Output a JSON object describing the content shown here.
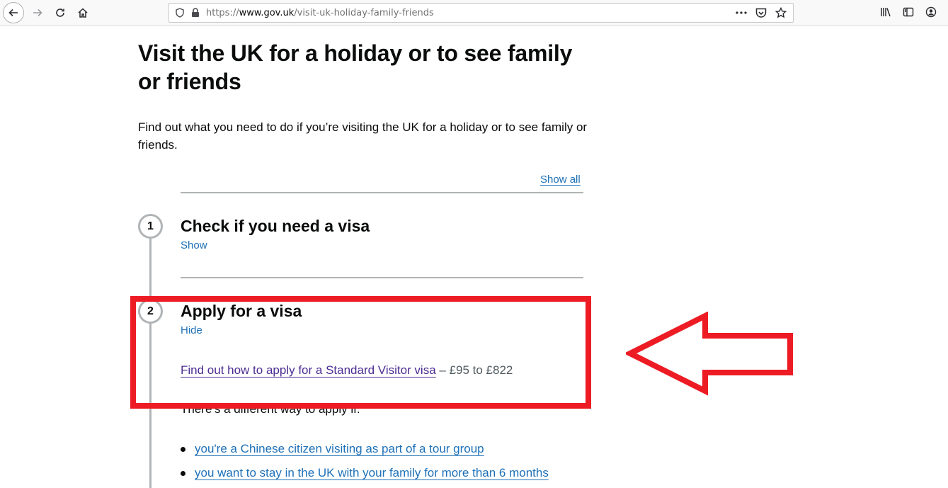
{
  "browser": {
    "url_prefix": "https://",
    "url_host": "www.gov.uk",
    "url_path": "/visit-uk-holiday-family-friends",
    "icons": [
      "back-icon",
      "forward-icon",
      "reload-icon",
      "home-icon",
      "shield-icon",
      "lock-icon",
      "more-icon",
      "pocket-icon",
      "star-icon",
      "library-icon",
      "sidebar-icon",
      "account-icon"
    ]
  },
  "page": {
    "title": "Visit the UK for a holiday or to see family or friends",
    "lead": "Find out what you need to do if you’re visiting the UK for a holiday or to see family or friends.",
    "show_all": "Show all"
  },
  "steps": [
    {
      "number": "1",
      "title": "Check if you need a visa",
      "toggle": "Show"
    },
    {
      "number": "2",
      "title": "Apply for a visa",
      "toggle": "Hide"
    }
  ],
  "step2_content": {
    "visa_link": "Find out how to apply for a Standard Visitor visa",
    "visa_cost": " – £95 to £822",
    "different_way": "There’s a different way to apply if:",
    "bullets": [
      "you're a Chinese citizen visiting as part of a tour group",
      "you want to stay in the UK with your family for more than 6 months"
    ]
  },
  "annotation": {
    "color": "#ed1c24"
  }
}
